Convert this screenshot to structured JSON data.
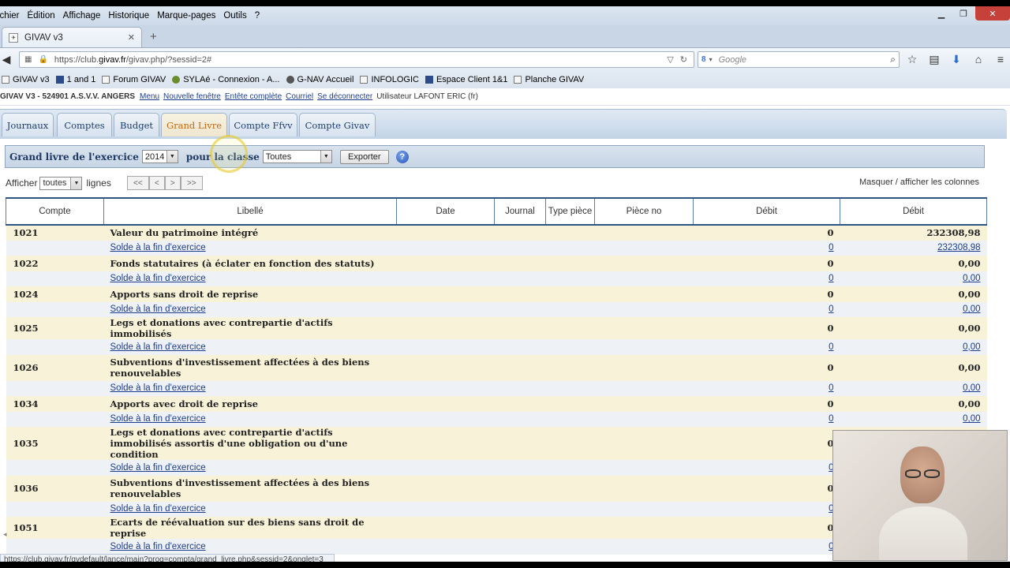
{
  "menubar": [
    "ichier",
    "Édition",
    "Affichage",
    "Historique",
    "Marque-pages",
    "Outils",
    "?"
  ],
  "browser_tab": {
    "title": "GIVAV v3"
  },
  "address": {
    "prefix": "https://club.",
    "domain": "givav.fr",
    "suffix": "/givav.php/?sessid=2#"
  },
  "search": {
    "placeholder": "Google"
  },
  "bookmarks": [
    "GIVAV v3",
    "1 and 1",
    "Forum GIVAV",
    "SYLAé - Connexion - A...",
    "G-NAV Accueil",
    "INFOLOGIC",
    "Espace Client 1&1",
    "Planche GIVAV"
  ],
  "appbar": {
    "brand": "GIVAV V3 - 524901 A.S.V.V. ANGERS",
    "links": [
      "Menu",
      "Nouvelle fenêtre",
      "Entête complète",
      "Courriel",
      "Se déconnecter"
    ],
    "user": "Utilisateur LAFONT ERIC (fr)"
  },
  "app_tabs": [
    "Journaux",
    "Comptes",
    "Budget",
    "Grand Livre",
    "Compte Ffvv",
    "Compte Givav"
  ],
  "filter": {
    "label1": "Grand livre de l'exercice",
    "year": "2014",
    "label2": "pour la classe",
    "classe": "Toutes",
    "export_label": "Exporter",
    "help": "?"
  },
  "pager": {
    "afficher": "Afficher",
    "value": "toutes",
    "lignes": "lignes",
    "buttons": [
      "<<",
      "<",
      ">",
      ">>"
    ]
  },
  "columns_toggle": "Masquer / afficher les colonnes",
  "table": {
    "headers": [
      "Compte",
      "Libellé",
      "Date",
      "Journal",
      "Type pièce",
      "Pièce no",
      "Débit",
      "Débit"
    ],
    "solde_label": "Solde à la fin d'exercice",
    "rows": [
      {
        "compte": "1021",
        "libelle": "Valeur du patrimoine intégré",
        "debit": "0",
        "debit2": "232308,98",
        "solde_debit": "0",
        "solde_debit2": "232308,98"
      },
      {
        "compte": "1022",
        "libelle": "Fonds statutaires (à éclater en fonction des statuts)",
        "debit": "0",
        "debit2": "0,00",
        "solde_debit": "0",
        "solde_debit2": "0,00"
      },
      {
        "compte": "1024",
        "libelle": "Apports sans droit de reprise",
        "debit": "0",
        "debit2": "0,00",
        "solde_debit": "0",
        "solde_debit2": "0,00"
      },
      {
        "compte": "1025",
        "libelle": "Legs et donations avec contrepartie d'actifs immobilisés",
        "debit": "0",
        "debit2": "0,00",
        "solde_debit": "0",
        "solde_debit2": "0,00"
      },
      {
        "compte": "1026",
        "libelle": "Subventions d'investissement affectées à des biens renouvelables",
        "debit": "0",
        "debit2": "0,00",
        "solde_debit": "0",
        "solde_debit2": "0,00",
        "tall": true
      },
      {
        "compte": "1034",
        "libelle": "Apports avec droit de reprise",
        "debit": "0",
        "debit2": "0,00",
        "solde_debit": "0",
        "solde_debit2": "0,00"
      },
      {
        "compte": "1035",
        "libelle": "Legs et donations avec contrepartie d'actifs immobilisés assortis d'une obligation ou d'une condition",
        "debit": "0",
        "debit2": "",
        "solde_debit": "0",
        "solde_debit2": "",
        "tall": true
      },
      {
        "compte": "1036",
        "libelle": "Subventions d'investissement affectées à des biens renouvelables",
        "debit": "0",
        "debit2": "",
        "solde_debit": "0",
        "solde_debit2": "",
        "tall": true
      },
      {
        "compte": "1051",
        "libelle": "Ecarts de réévaluation sur des biens sans droit de reprise",
        "debit": "0",
        "debit2": "",
        "solde_debit": "0",
        "solde_debit2": ""
      }
    ]
  },
  "status_url": "https://club.givav.fr/gvdefault/lance/main?prog=compta/grand_livre.php&sessid=2&onglet=3"
}
